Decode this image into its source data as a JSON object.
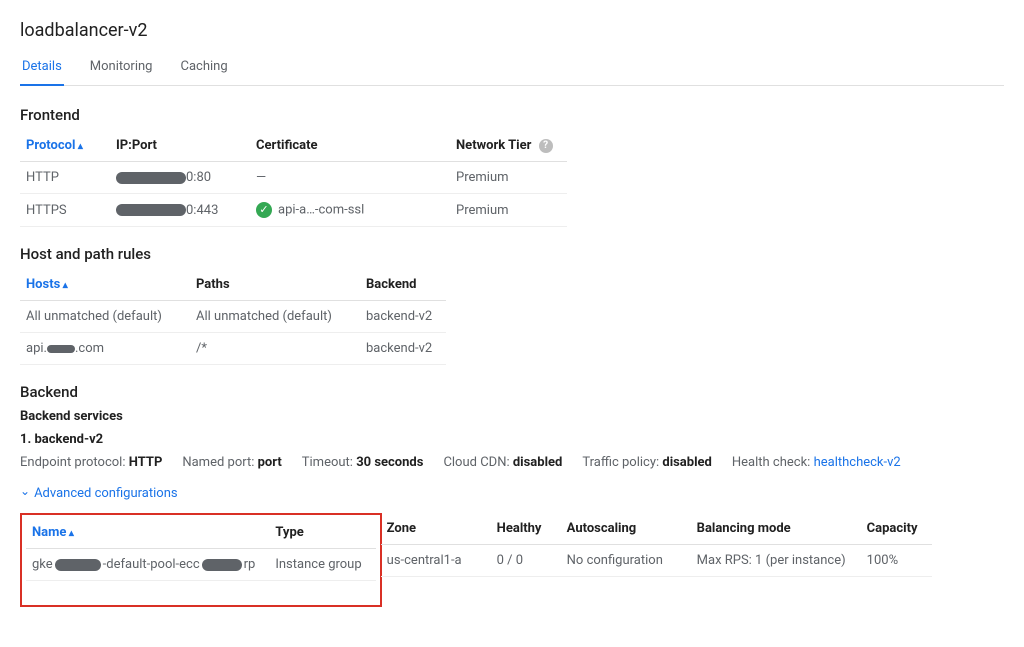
{
  "title": "loadbalancer-v2",
  "tabs": {
    "details": "Details",
    "monitoring": "Monitoring",
    "caching": "Caching"
  },
  "frontend": {
    "heading": "Frontend",
    "cols": {
      "protocol": "Protocol",
      "ipport": "IP:Port",
      "cert": "Certificate",
      "tier": "Network Tier"
    },
    "rows": [
      {
        "protocol": "HTTP",
        "port_suffix": "0:80",
        "cert": "—",
        "tier": "Premium"
      },
      {
        "protocol": "HTTPS",
        "port_suffix": "0:443",
        "cert": "api-a…-com-ssl",
        "tier": "Premium"
      }
    ]
  },
  "hostpath": {
    "heading": "Host and path rules",
    "cols": {
      "hosts": "Hosts",
      "paths": "Paths",
      "backend": "Backend"
    },
    "rows": [
      {
        "hosts": "All unmatched (default)",
        "paths": "All unmatched (default)",
        "backend": "backend-v2"
      },
      {
        "hosts_pre": "api.",
        "hosts_post": ".com",
        "paths": "/*",
        "backend": "backend-v2"
      }
    ]
  },
  "backend": {
    "heading": "Backend",
    "services_heading": "Backend services",
    "service_label": "1. backend-v2",
    "props": {
      "endpoint_label": "Endpoint protocol:",
      "endpoint_val": "HTTP",
      "namedport_label": "Named port:",
      "namedport_val": "port",
      "timeout_label": "Timeout:",
      "timeout_val": "30 seconds",
      "cdn_label": "Cloud CDN:",
      "cdn_val": "disabled",
      "traffic_label": "Traffic policy:",
      "traffic_val": "disabled",
      "hc_label": "Health check:",
      "hc_val": "healthcheck-v2"
    },
    "adv": "Advanced configurations",
    "cols": {
      "name": "Name",
      "type": "Type",
      "zone": "Zone",
      "healthy": "Healthy",
      "autoscaling": "Autoscaling",
      "balancing": "Balancing mode",
      "capacity": "Capacity"
    },
    "row": {
      "name_pre": "gke",
      "name_mid": "-default-pool-ecc",
      "name_post": "rp",
      "type": "Instance group",
      "zone": "us-central1-a",
      "healthy": "0 / 0",
      "autoscaling": "No configuration",
      "balancing": "Max RPS: 1 (per instance)",
      "capacity": "100%"
    }
  }
}
